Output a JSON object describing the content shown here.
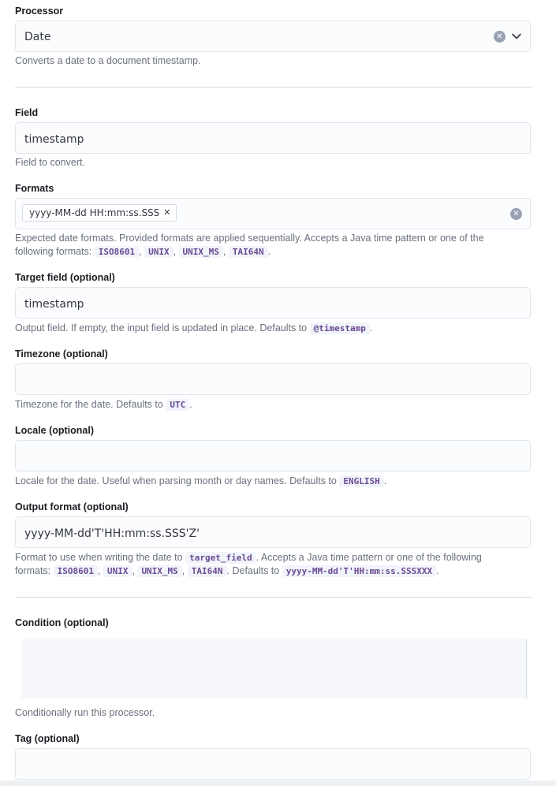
{
  "processor": {
    "label": "Processor",
    "value": "Date",
    "help": "Converts a date to a document timestamp.",
    "clear_icon": "clear-icon",
    "chevron_icon": "chevron-down-icon"
  },
  "field": {
    "label": "Field",
    "value": "timestamp",
    "help": "Field to convert."
  },
  "formats": {
    "label": "Formats",
    "pill": "yyyy-MM-dd HH:mm:ss.SSS",
    "pill_remove": "✕",
    "help_text": "Expected date formats. Provided formats are applied sequentially. Accepts a Java time pattern or one of the following formats:",
    "codes": [
      "ISO8601",
      "UNIX",
      "UNIX_MS",
      "TAI64N"
    ],
    "sep": ",",
    "end": "."
  },
  "target_field": {
    "label": "Target field (optional)",
    "value": "timestamp",
    "help_text": "Output field. If empty, the input field is updated in place. Defaults to",
    "code": "@timestamp",
    "end": "."
  },
  "timezone": {
    "label": "Timezone (optional)",
    "value": "",
    "help_text": "Timezone for the date. Defaults to",
    "code": "UTC",
    "end": "."
  },
  "locale": {
    "label": "Locale (optional)",
    "value": "",
    "help_text": "Locale for the date. Useful when parsing month or day names. Defaults to",
    "code": "ENGLISH",
    "end": "."
  },
  "output_format": {
    "label": "Output format (optional)",
    "value": "yyyy-MM-dd'T'HH:mm:ss.SSS'Z'",
    "help_1": "Format to use when writing the date to",
    "code_target": "target_field",
    "help_2": ". Accepts a Java time pattern or one of the following",
    "help_3": "formats:",
    "codes": [
      "ISO8601",
      "UNIX",
      "UNIX_MS",
      "TAI64N"
    ],
    "sep": ",",
    "help_4": ". Defaults to",
    "code_default": "yyyy-MM-dd'T'HH:mm:ss.SSSXXX",
    "end": "."
  },
  "condition": {
    "label": "Condition (optional)",
    "help": "Conditionally run this processor."
  },
  "tag": {
    "label": "Tag (optional)",
    "value": ""
  }
}
